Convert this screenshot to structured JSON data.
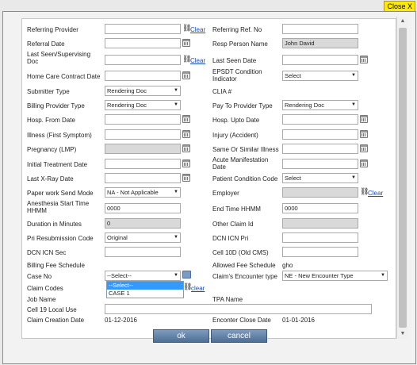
{
  "close_label": "Close X",
  "fields": {
    "referring_provider": "Referring Provider",
    "referring_ref_no": "Referring Ref. No",
    "referral_date": "Referral Date",
    "resp_person_name": "Resp Person Name",
    "resp_person_value": "John David",
    "last_seen_doc": "Last Seen/Supervising Doc",
    "last_seen_date": "Last Seen Date",
    "home_care_contract_date": "Home Care Contract Date",
    "epsdt_condition_indicator": "EPSDT Condition Indicator",
    "epsdt_value": "Select",
    "submitter_type": "Submitter Type",
    "submitter_type_value": "Rendering Doc",
    "clia": "CLIA #",
    "billing_provider_type": "Billing Provider Type",
    "billing_provider_type_value": "Rendering Doc",
    "pay_to_provider_type": "Pay To Provider Type",
    "pay_to_provider_type_value": "Rendering Doc",
    "hosp_from_date": "Hosp. From Date",
    "hosp_upto_date": "Hosp. Upto Date",
    "illness": "Illness (First Symptom)",
    "injury": "Injury (Accident)",
    "pregnancy": "Pregnancy (LMP)",
    "same_or_similar_illness": "Same Or Similar Illness",
    "initial_treatment_date": "Initial Treatment Date",
    "acute_manifestation_date": "Acute Manifestation Date",
    "last_xray_date": "Last X-Ray Date",
    "patient_condition_code": "Patient Condition Code",
    "patient_condition_code_value": "Select",
    "paper_work_send_mode": "Paper work Send Mode",
    "paper_work_send_mode_value": "NA - Not Applicable",
    "employer": "Employer",
    "anesthesia_start_time": "Anesthesia Start Time HHMM",
    "anesthesia_start_value": "0000",
    "end_time": "End Time HHMM",
    "end_time_value": "0000",
    "duration": "Duration in Minutes",
    "duration_value": "0",
    "other_claim_id": "Other Claim Id",
    "pri_resubmission_code": "Pri Resubmission Code",
    "pri_resubmission_value": "Original",
    "dcn_icn_pri": "DCN ICN Pri",
    "dcn_icn_sec": "DCN ICN Sec",
    "cell_10d": "Cell 10D (Old CMS)",
    "billing_fee_schedule": "Billing Fee Schedule",
    "allowed_fee_schedule": "Allowed Fee Schedule",
    "allowed_fee_schedule_value": "gho",
    "case_no": "Case No",
    "case_no_value": "--Select--",
    "claims_encounter_type": "Claim's Encounter type",
    "claims_encounter_type_value": "NE - New Encounter Type",
    "claim_codes": "Claim Codes",
    "job_name": "Job Name",
    "tpa_name": "TPA Name",
    "cell19_local_use": "Cell 19 Local Use",
    "claim_creation_date": "Claim Creation Date",
    "claim_creation_date_value": "01-12-2016",
    "encounter_close_date": "Enconter Close Date",
    "encounter_close_date_value": "01-01-2016"
  },
  "links": {
    "clear": "Clear",
    "clear_lower": "clear"
  },
  "case_no_options": [
    "--Select--",
    "CASE 1"
  ],
  "buttons": {
    "ok": "ok",
    "cancel": "cancel"
  }
}
